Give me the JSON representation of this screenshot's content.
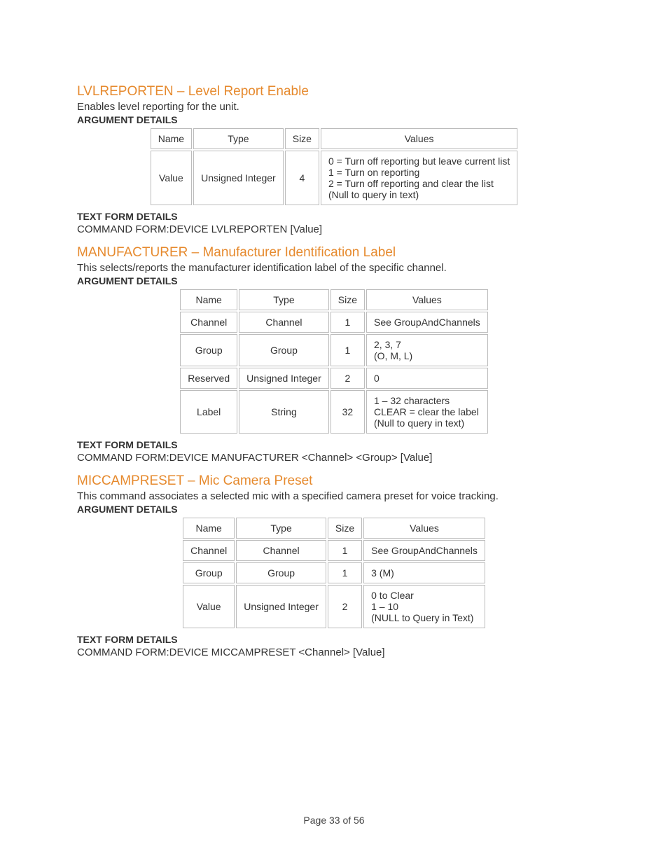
{
  "footer": "Page 33 of 56",
  "labels": {
    "argument_details": "ARGUMENT DETAILS",
    "text_form_details": "TEXT FORM DETAILS"
  },
  "table_headers": [
    "Name",
    "Type",
    "Size",
    "Values"
  ],
  "sections": [
    {
      "title": "LVLREPORTEN – Level Report Enable",
      "desc": "Enables level reporting for the unit.",
      "command_form": "COMMAND FORM:DEVICE LVLREPORTEN [Value]",
      "rows": [
        {
          "name": "Value",
          "type": "Unsigned Integer",
          "size": "4",
          "values": [
            "0 = Turn off reporting but leave current list",
            "1 = Turn on reporting",
            "2 = Turn off reporting and clear the list",
            "(Null to query in text)"
          ]
        }
      ]
    },
    {
      "title": "MANUFACTURER – Manufacturer Identification Label",
      "desc": "This selects/reports the manufacturer identification label of the specific channel.",
      "command_form": "COMMAND FORM:DEVICE MANUFACTURER <Channel> <Group> [Value]",
      "rows": [
        {
          "name": "Channel",
          "type": "Channel",
          "size": "1",
          "values": [
            "See GroupAndChannels"
          ]
        },
        {
          "name": "Group",
          "type": "Group",
          "size": "1",
          "values": [
            "2, 3, 7",
            "(O, M, L)"
          ]
        },
        {
          "name": "Reserved",
          "type": "Unsigned Integer",
          "size": "2",
          "values": [
            "0"
          ]
        },
        {
          "name": "Label",
          "type": "String",
          "size": "32",
          "values": [
            "1 – 32 characters",
            "CLEAR = clear the label",
            "(Null to query in text)"
          ]
        }
      ]
    },
    {
      "title": "MICCAMPRESET – Mic Camera Preset",
      "desc": "This command associates a selected mic with a specified camera preset for voice tracking.",
      "command_form": "COMMAND FORM:DEVICE MICCAMPRESET <Channel> [Value]",
      "rows": [
        {
          "name": "Channel",
          "type": "Channel",
          "size": "1",
          "values": [
            "See GroupAndChannels"
          ]
        },
        {
          "name": "Group",
          "type": "Group",
          "size": "1",
          "values": [
            "3 (M)"
          ]
        },
        {
          "name": "Value",
          "type": "Unsigned Integer",
          "size": "2",
          "values": [
            "0 to Clear",
            "1 – 10",
            "(NULL to Query in Text)"
          ]
        }
      ]
    }
  ]
}
